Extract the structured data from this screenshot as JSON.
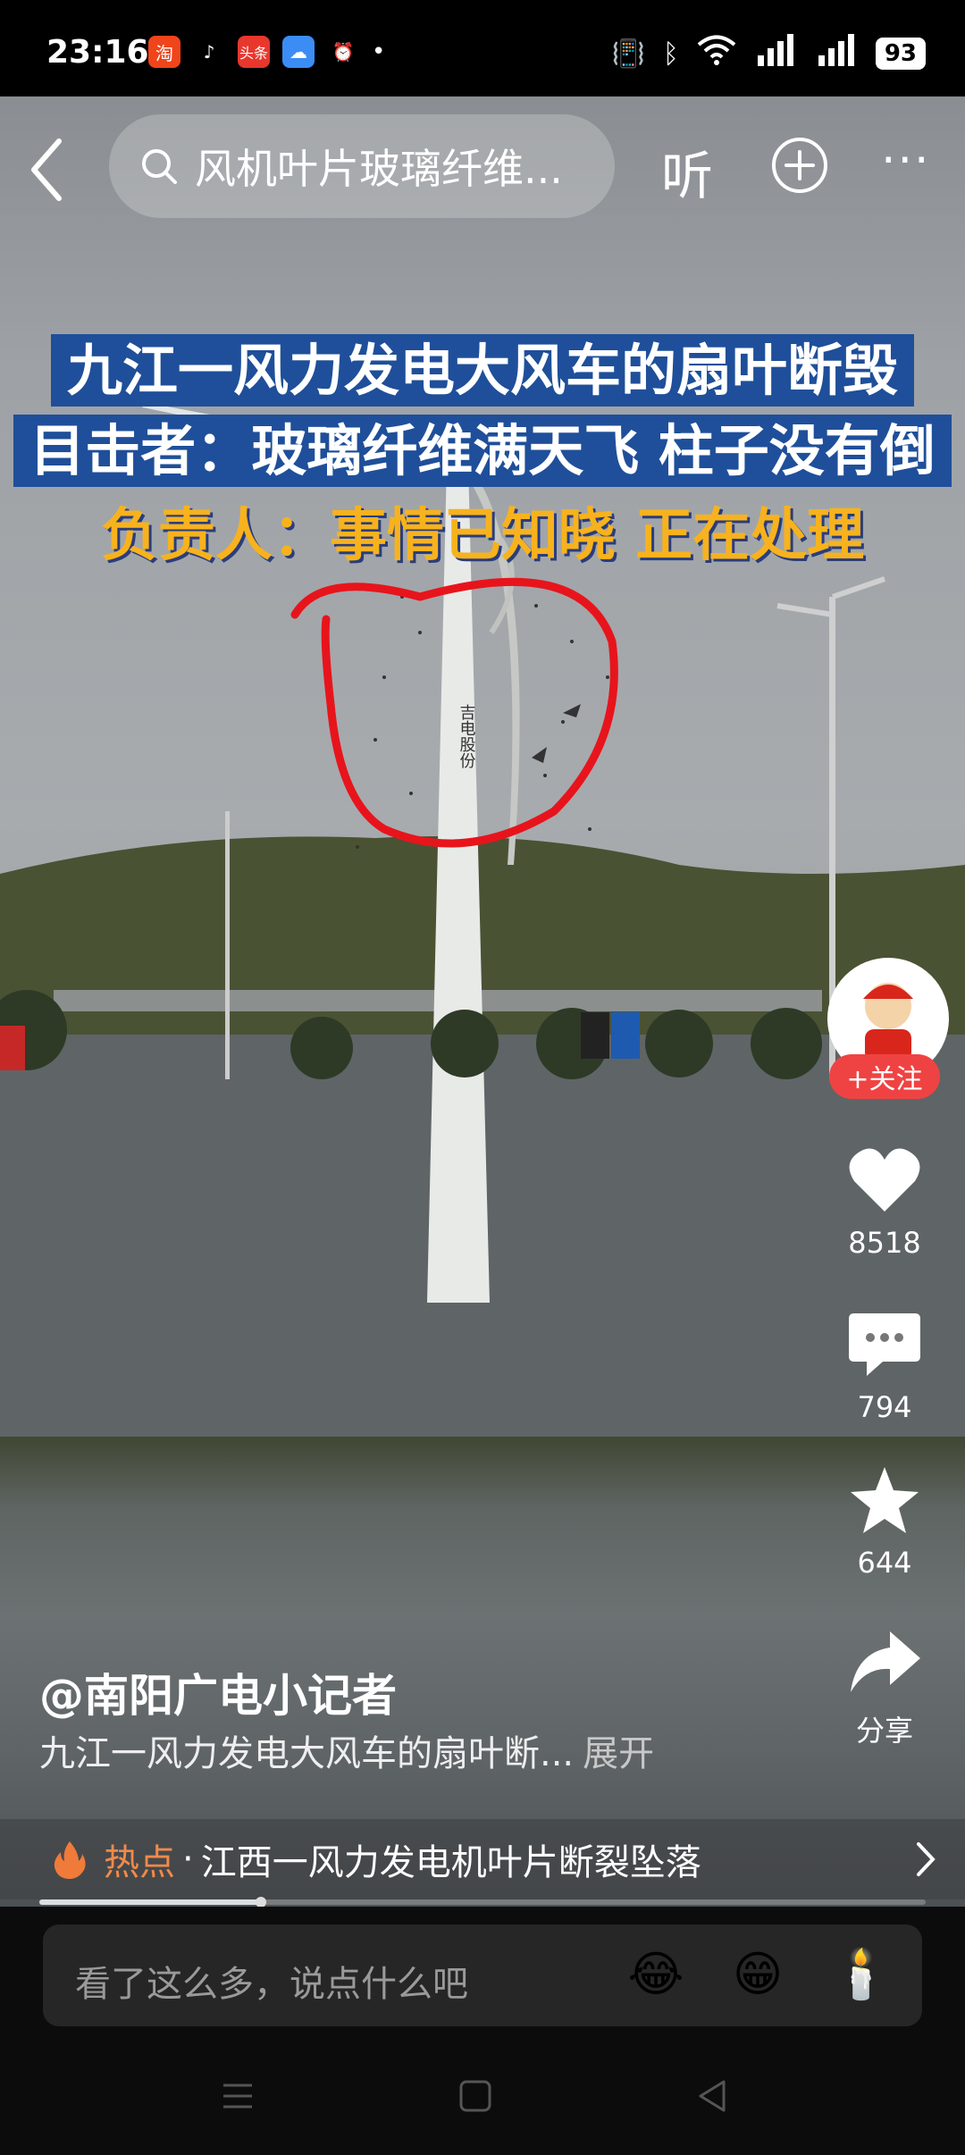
{
  "status": {
    "time": "23:16",
    "app_icons": [
      "taobao-icon",
      "tiktok-icon",
      "toutiao-icon",
      "weather-icon",
      "alarm-icon"
    ],
    "dot": "•",
    "battery": "93"
  },
  "top": {
    "search_text": "风机叶片玻璃纤维...",
    "listen_label": "听"
  },
  "headline": {
    "line1": "九江一风力发电大风车的扇叶断毁",
    "line2": "目击者：玻璃纤维满天飞 柱子没有倒",
    "line3": "负责人：事情已知晓 正在处理"
  },
  "tower_text": "吉电股份",
  "rail": {
    "follow_label": "+关注",
    "likes": "8518",
    "comments": "794",
    "favorites": "644",
    "share_label": "分享"
  },
  "info": {
    "author": "@南阳广电小记者",
    "description": "九江一风力发电大风车的扇叶断...",
    "expand_label": "展开"
  },
  "hot": {
    "tag": "热点",
    "sep": "·",
    "text": "江西一风力发电机叶片断裂坠落"
  },
  "progress": 0.25,
  "comment": {
    "placeholder": "看了这么多，说点什么吧",
    "emojis": [
      "😂",
      "😁",
      "🕯️"
    ]
  },
  "colors": {
    "accent_red": "#ef4343",
    "hot_orange": "#f08a4b",
    "headline_blue": "#1f4f9a",
    "headline_yellow": "#f7b21d"
  }
}
